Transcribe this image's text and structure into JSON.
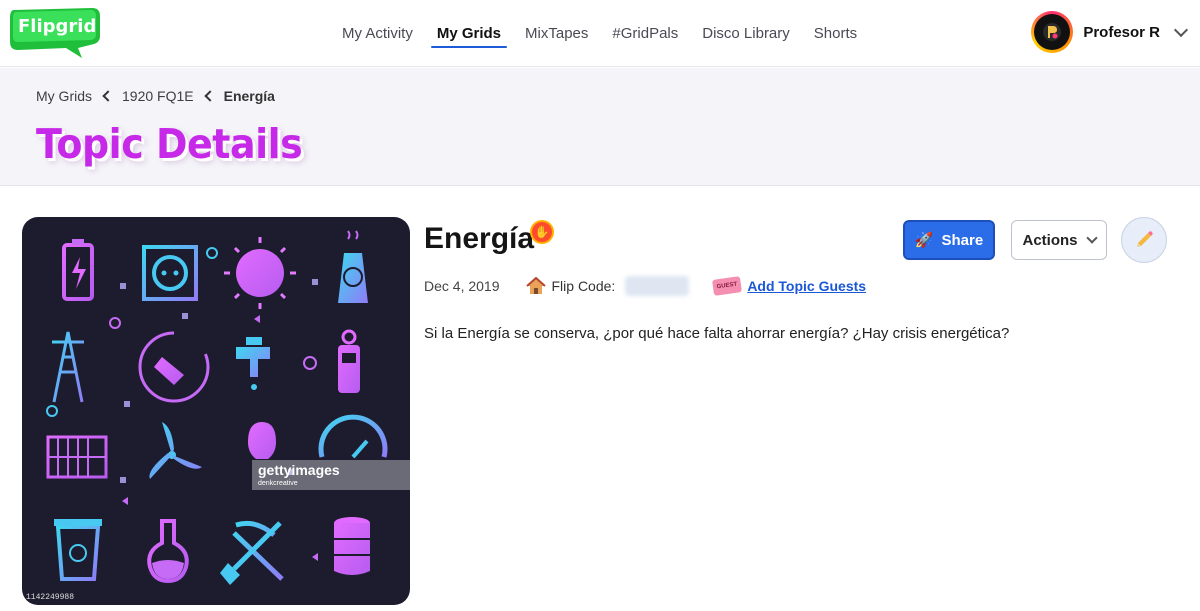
{
  "app": {
    "logo_text": "Flipgrid",
    "brand_color": "#2bd14c",
    "accent": "#1d5bd8"
  },
  "nav": {
    "items": [
      {
        "label": "My Activity",
        "active": false
      },
      {
        "label": "My Grids",
        "active": true
      },
      {
        "label": "MixTapes",
        "active": false
      },
      {
        "label": "#GridPals",
        "active": false
      },
      {
        "label": "Disco Library",
        "active": false
      },
      {
        "label": "Shorts",
        "active": false
      }
    ]
  },
  "profile": {
    "name": "Profesor R",
    "icon": "chevron-down-icon"
  },
  "breadcrumb": {
    "items": [
      "My Grids",
      "1920 FQ1E"
    ],
    "current": "Energía"
  },
  "page_title": "Topic Details",
  "media": {
    "watermark": "gettyimages",
    "watermark_credit": "denkcreative",
    "photo_id": "1142249988"
  },
  "topic": {
    "title": "Energía",
    "date": "Dec 4, 2019",
    "flip_code_label": "Flip Code:",
    "add_guests_label": "Add Topic Guests",
    "guest_ticket_text": "GUEST",
    "prompt": "Si la Energía se conserva, ¿por qué hace falta ahorrar energía? ¿Hay crisis energética?"
  },
  "buttons": {
    "share": "Share",
    "actions": "Actions"
  }
}
